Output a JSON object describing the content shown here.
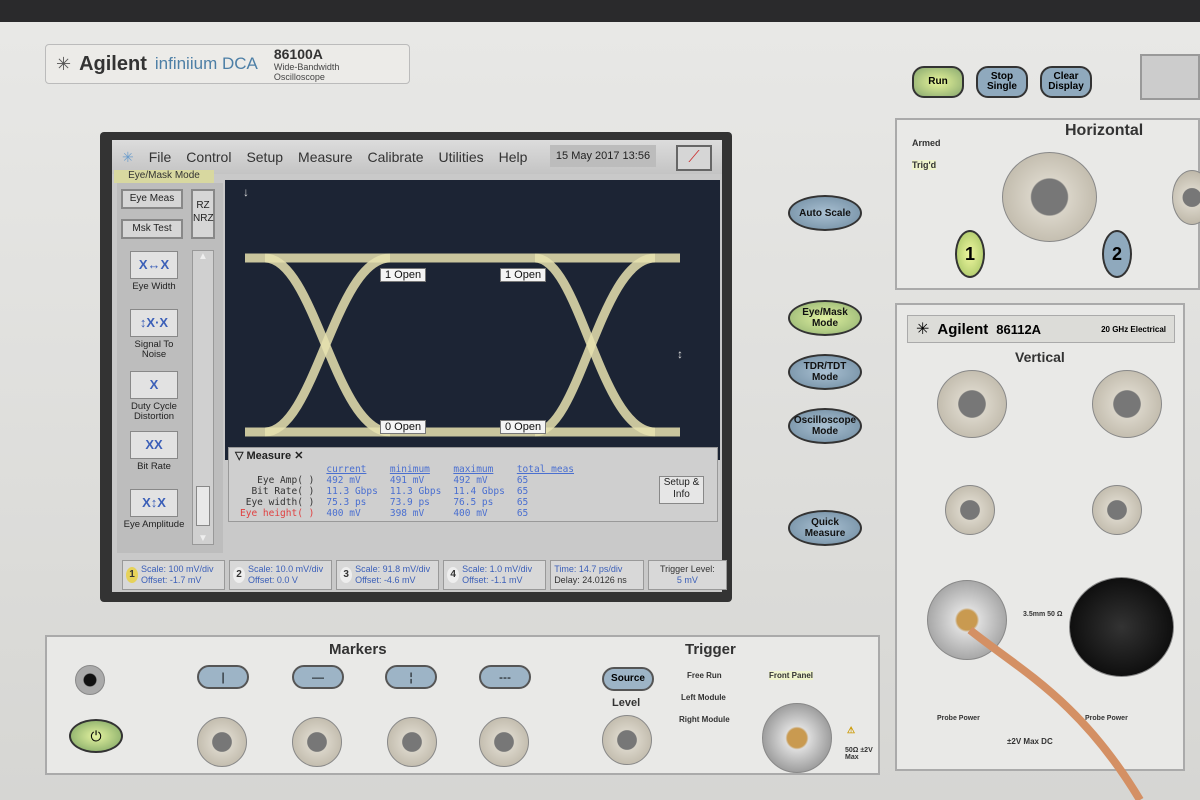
{
  "instrument": {
    "brand": "Agilent",
    "line": "infiniium DCA",
    "model": "86100A",
    "desc1": "Wide-Bandwidth",
    "desc2": "Oscilloscope"
  },
  "menu": [
    "File",
    "Control",
    "Setup",
    "Measure",
    "Calibrate",
    "Utilities",
    "Help"
  ],
  "datetime": "15 May 2017   13:56",
  "mode_label": "Eye/Mask Mode",
  "toolbar": {
    "eye_meas": "Eye Meas",
    "mask_test": "Msk Test",
    "rz": "RZ",
    "nrz": "NRZ",
    "tools": [
      {
        "label": "Eye Width",
        "glyph": "X↔X"
      },
      {
        "label": "Signal To Noise",
        "glyph": "↕X·X"
      },
      {
        "label": "Duty Cycle Distortion",
        "glyph": "X"
      },
      {
        "label": "Bit Rate",
        "glyph": "XX"
      },
      {
        "label": "Eye Amplitude",
        "glyph": "X↕X"
      }
    ]
  },
  "markers_on_screen": {
    "top_left": "1 Open",
    "top_right": "1 Open",
    "bottom_left": "0 Open",
    "bottom_right": "0 Open"
  },
  "measure": {
    "title": "Measure",
    "headers": [
      "current",
      "minimum",
      "maximum",
      "total meas"
    ],
    "rows": [
      {
        "name": "Eye Amp(  )",
        "values": [
          "492 mV",
          "491 mV",
          "492 mV",
          "65"
        ]
      },
      {
        "name": "Bit Rate(  )",
        "values": [
          "11.3 Gbps",
          "11.3 Gbps",
          "11.4 Gbps",
          "65"
        ]
      },
      {
        "name": "Eye width(  )",
        "values": [
          "75.3 ps",
          "73.9 ps",
          "76.5 ps",
          "65"
        ]
      },
      {
        "name": "Eye height(  )",
        "values": [
          "400 mV",
          "398 mV",
          "400 mV",
          "65"
        ]
      }
    ],
    "setup_info": "Setup & Info"
  },
  "status": [
    {
      "ch": "1",
      "scale": "Scale: 100 mV/div",
      "offset": "Offset: -1.7 mV"
    },
    {
      "ch": "2",
      "scale": "Scale: 10.0 mV/div",
      "offset": "Offset: 0.0 V"
    },
    {
      "ch": "3",
      "scale": "Scale: 91.8 mV/div",
      "offset": "Offset: -4.6 mV"
    },
    {
      "ch": "4",
      "scale": "Scale: 1.0 mV/div",
      "offset": "Offset: -1.1 mV"
    }
  ],
  "time": {
    "time": "Time: 14.7 ps/div",
    "delay": "Delay: 24.0126 ns"
  },
  "trigger_level": {
    "label": "Trigger Level:",
    "value": "5 mV"
  },
  "front_buttons": {
    "auto_scale": "Auto Scale",
    "eye_mask": "Eye/Mask Mode",
    "tdr": "TDR/TDT Mode",
    "osc": "Oscilloscope Mode",
    "quick": "Quick Measure",
    "run": "Run",
    "stop": "Stop Single",
    "clear": "Clear Display"
  },
  "horizontal": {
    "title": "Horizontal",
    "armed": "Armed",
    "trigd": "Trig'd",
    "b1": "1",
    "b2": "2"
  },
  "module": {
    "brand": "Agilent",
    "model": "86112A",
    "desc": "20 GHz Electrical",
    "vertical": "Vertical",
    "conn": "3.5mm 50 Ω",
    "probe_power": "Probe Power",
    "max": "±2V Max DC"
  },
  "markers_panel": {
    "title": "Markers",
    "buttons": [
      "|",
      "—",
      "¦",
      "---"
    ]
  },
  "trigger_panel": {
    "title": "Trigger",
    "source": "Source",
    "level": "Level",
    "options": [
      "Free Run",
      "Left Module",
      "Right Module"
    ],
    "front": "Front Panel",
    "rating": "50Ω ±2V Max"
  }
}
